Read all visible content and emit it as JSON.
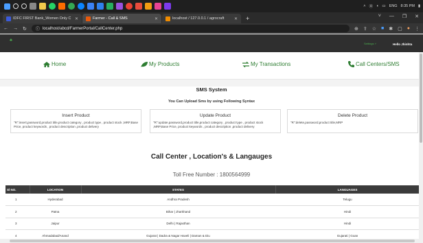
{
  "os": {
    "clock_time": "8:35 PM",
    "language": "ENG"
  },
  "browser": {
    "tabs": [
      {
        "title": "IDFC FIRST Bank_Women Only C",
        "active": false,
        "favicon_color": "#3b5bdb"
      },
      {
        "title": "Farmer - Call & SMS",
        "active": true,
        "favicon_color": "#e8590c"
      },
      {
        "title": "localhost / 127.0.0.1 / agrocraft",
        "active": false,
        "favicon_color": "#f08c00"
      }
    ],
    "new_tab": "+",
    "url": "localhost/abcd/FarmerPortal/CallCenter.php"
  },
  "app": {
    "settings_label": "Settings ˅",
    "greeting": "Hello Jhinhta"
  },
  "menu": [
    {
      "label": "Home",
      "icon": "home-icon"
    },
    {
      "label": "My Products",
      "icon": "leaf-icon"
    },
    {
      "label": "My Transactions",
      "icon": "exchange-icon"
    },
    {
      "label": "Call Centers/SMS",
      "icon": "phone-icon"
    }
  ],
  "sms": {
    "title": "SMS System",
    "subtitle": "You Can Upload Sms by using Following Syntax",
    "cards": [
      {
        "title": "Insert Product",
        "text": "\"R\":insert,password,product title,product category , product type , product stock ,MRP,Base Price, product keywords , product description ,product delivery"
      },
      {
        "title": "Update Product",
        "text": "\"R\":update,password,product title,product category , product type , product stock ,MRP,Base Price, product keywords , product description ,product delivery"
      },
      {
        "title": "Delete Product",
        "text": "\"R\":delete,password,product title,MRP"
      }
    ]
  },
  "callcenter": {
    "title": "Call Center , Location's & Langauges",
    "toll_free": "Toll Free Number : 1800564999",
    "columns": [
      "Sl NO.",
      "LOCATION",
      "STATES",
      "LANGUAGES"
    ],
    "rows": [
      [
        "1",
        "Hyderabad",
        "Andhra Pradesh",
        "Telugu"
      ],
      [
        "2",
        "Patna",
        "Bihar | Jharkhand",
        "Hindi"
      ],
      [
        "3",
        "Jaipur",
        "Delhi | Rajasthan",
        "Hindi"
      ],
      [
        "4",
        "Ahmadabad/Anand",
        "Gujarat | Dadra & Nagar Haveli | Daman & Diu",
        "Gujarati | Goan"
      ]
    ]
  }
}
